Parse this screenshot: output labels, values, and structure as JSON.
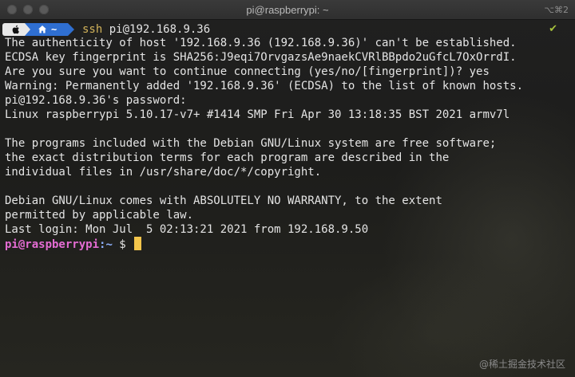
{
  "window": {
    "title": "pi@raspberrypi: ~",
    "shortcut": "⌥⌘2"
  },
  "prompt_bar": {
    "icon": "apple-icon",
    "home_icon": "home-icon",
    "home_label": "~",
    "command_name": "ssh",
    "command_arg": " pi@192.168.9.36",
    "status_icon": "checkmark-icon",
    "status_glyph": "✔"
  },
  "output_lines": [
    "The authenticity of host '192.168.9.36 (192.168.9.36)' can't be established.",
    "ECDSA key fingerprint is SHA256:J9eqi7OrvgazsAe9naekCVRlBBpdo2uGfcL7OxOrrdI.",
    "Are you sure you want to continue connecting (yes/no/[fingerprint])? yes",
    "Warning: Permanently added '192.168.9.36' (ECDSA) to the list of known hosts.",
    "pi@192.168.9.36's password:",
    "Linux raspberrypi 5.10.17-v7+ #1414 SMP Fri Apr 30 13:18:35 BST 2021 armv7l",
    "",
    "The programs included with the Debian GNU/Linux system are free software;",
    "the exact distribution terms for each program are described in the",
    "individual files in /usr/share/doc/*/copyright.",
    "",
    "Debian GNU/Linux comes with ABSOLUTELY NO WARRANTY, to the extent",
    "permitted by applicable law.",
    "Last login: Mon Jul  5 02:13:21 2021 from 192.168.9.50"
  ],
  "remote_prompt": {
    "user_host": "pi@raspberrypi",
    "path": ":~",
    "symbol": " $ "
  },
  "watermark": "@稀土掘金技术社区",
  "colors": {
    "command_name": "#d2b35a",
    "prompt_user": "#e46cd3",
    "prompt_path": "#8fb2ff",
    "cursor": "#f3c54b",
    "home_segment": "#2f6fd1",
    "check": "#a7c23c"
  }
}
